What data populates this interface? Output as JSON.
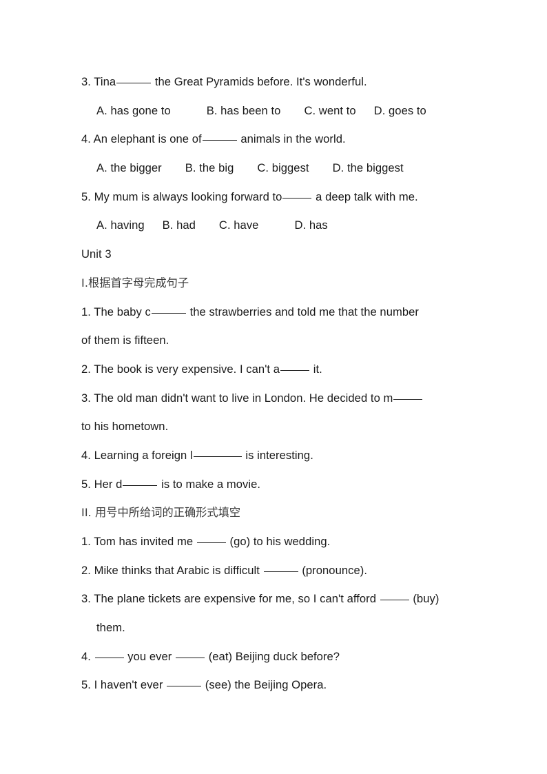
{
  "document": {
    "type": "english-exercise-worksheet",
    "language_mix": [
      "en",
      "zh"
    ],
    "text_color": "#1a1a1a",
    "heading_color": "#3b3b3b",
    "background": "#ffffff"
  },
  "content": {
    "q3": {
      "stem_before": "3. Tina",
      "stem_after": "the Great Pyramids before. It's wonderful.",
      "options": [
        "A. has gone to",
        "B. has been to",
        "C. went to",
        "D. goes to"
      ]
    },
    "q4": {
      "stem_before": "4. An elephant is one of",
      "stem_after": "animals in the world.",
      "options": [
        "A. the bigger",
        "B. the big",
        "C. biggest",
        "D. the biggest"
      ]
    },
    "q5": {
      "stem_before": "5. My mum is always looking forward to",
      "stem_after": "a deep talk with me.",
      "options": [
        "A. having",
        "B. had",
        "C. have",
        "D. has"
      ]
    },
    "unit_title": "Unit 3",
    "section_one": {
      "heading": "I.根据首字母完成句子",
      "items": [
        {
          "before": "1. The baby c",
          "after": "the strawberries and told me that the number",
          "continuation": "of them is fifteen."
        },
        {
          "before": "2. The book is very expensive. I can't a",
          "after": "it.",
          "continuation": ""
        },
        {
          "before": "3. The old man didn't want to live in London. He decided to m",
          "after": "",
          "continuation": "to his hometown."
        },
        {
          "before": "4. Learning a foreign l",
          "after": "is interesting.",
          "continuation": ""
        },
        {
          "before": "5. Her d",
          "after": "is to make a movie.",
          "continuation": ""
        }
      ]
    },
    "section_two": {
      "heading": "II. 用号中所给词的正确形式填空",
      "items": [
        {
          "before": "1. Tom has invited me",
          "after": "(go) to his wedding.",
          "continuation": ""
        },
        {
          "before": "2. Mike thinks that Arabic is difficult",
          "after": "(pronounce).",
          "continuation": ""
        },
        {
          "before": "3. The plane tickets are expensive for me, so I can't afford",
          "after": "(buy)",
          "continuation": "them."
        },
        {
          "before": "4.",
          "middle": "you ever",
          "after": "(eat) Beijing duck before?",
          "continuation": ""
        },
        {
          "before": "5. I haven't ever",
          "after": "(see) the Beijing Opera.",
          "continuation": ""
        }
      ]
    }
  }
}
